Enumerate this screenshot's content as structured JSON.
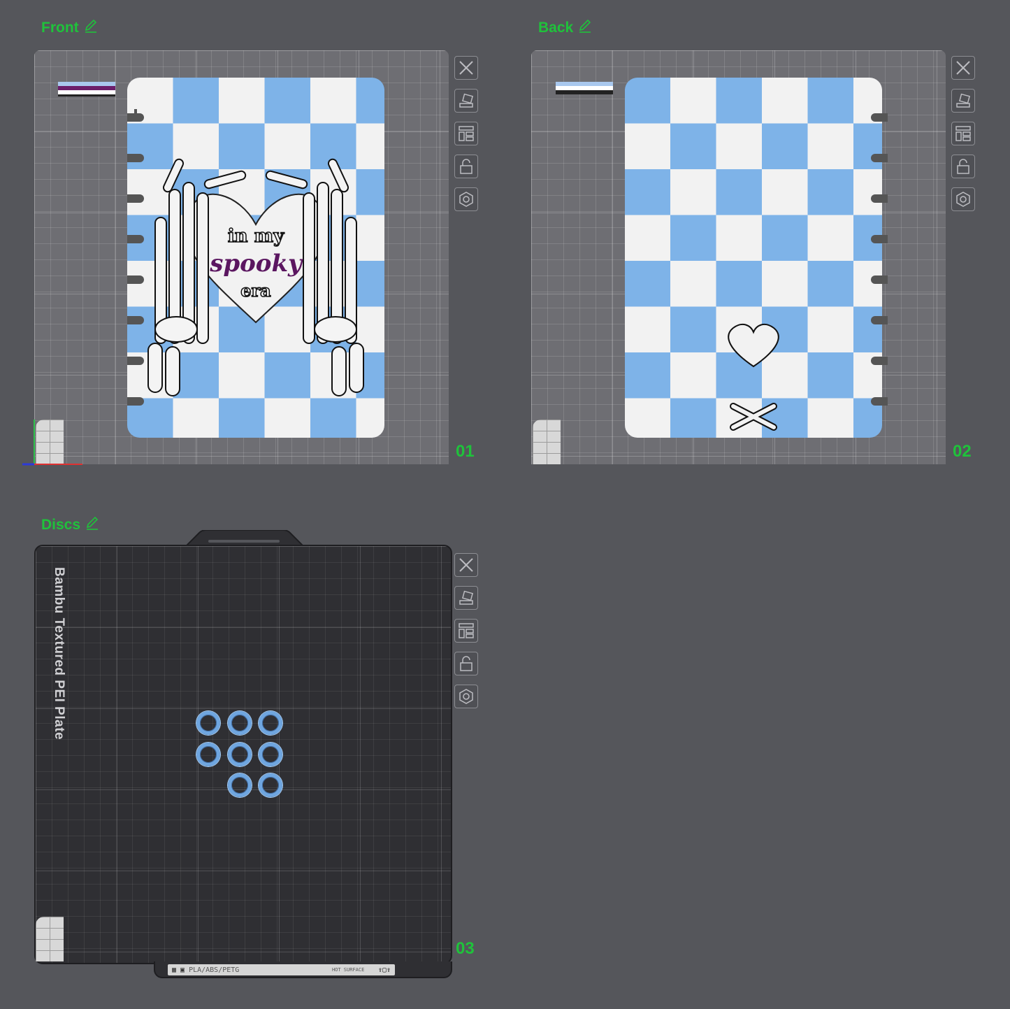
{
  "plates": [
    {
      "name": "Front",
      "number": "01",
      "edit_icon": "pencil-icon",
      "filament_colors": [
        "#a9c8ee",
        "#6b1e6b",
        "#ffffff",
        "#222222"
      ]
    },
    {
      "name": "Back",
      "number": "02",
      "edit_icon": "pencil-icon",
      "filament_colors": [
        "#a9c8ee",
        "#ffffff",
        "#222222"
      ]
    },
    {
      "name": "Discs",
      "number": "03",
      "edit_icon": "pencil-icon"
    }
  ],
  "toolbar_icons": [
    "close-icon",
    "auto-orient-icon",
    "arrange-icon",
    "lock-icon",
    "settings-icon"
  ],
  "front_artwork": {
    "line1": "in my",
    "line2": "spooky",
    "line3": "era"
  },
  "plate_type_label": "Bambu Textured PEI Plate",
  "plate_strip_text": "PLA/ABS/PETG",
  "plate_strip_note": "HOT SURFACE",
  "colors": {
    "accent": "#1fc23b",
    "checker_blue": "#7eb3e8",
    "disc_blue": "#6fa6e0",
    "purple_text": "#5b1660"
  }
}
